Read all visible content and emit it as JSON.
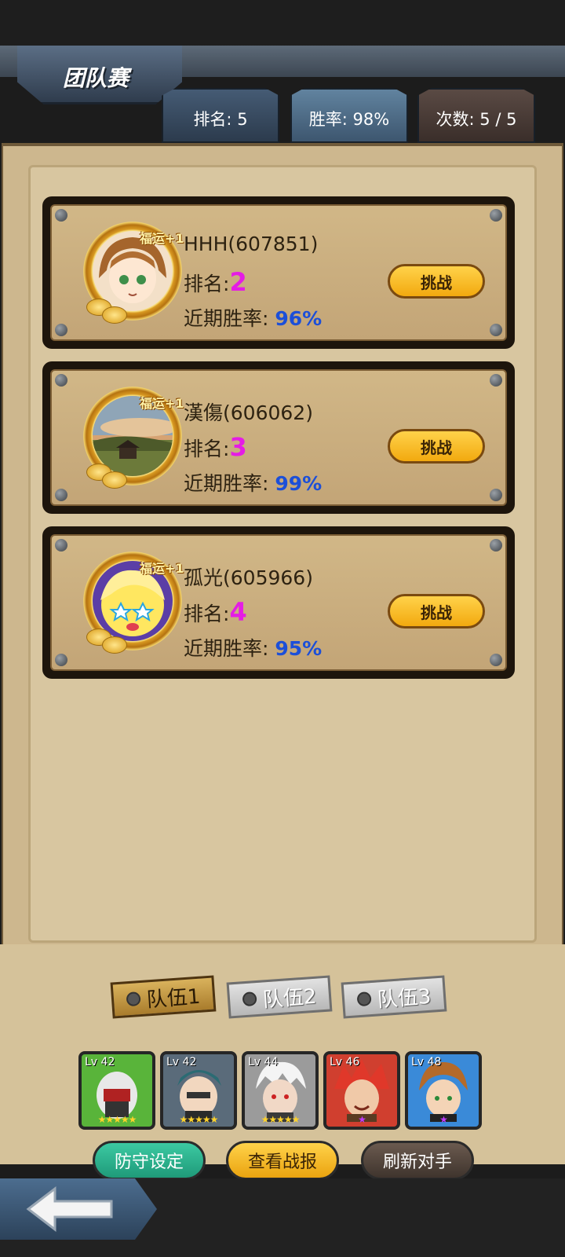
{
  "header": {
    "title": "团队赛",
    "stats": [
      {
        "label": "排名: 5"
      },
      {
        "label": "胜率: 98%"
      },
      {
        "label": "次数: 5 / 5"
      }
    ]
  },
  "opponents": [
    {
      "name": "HHH(607851)",
      "rank_label": "排名:",
      "rank": "2",
      "winrate_label": "近期胜率:",
      "winrate": "96%",
      "luck": "福运+1",
      "button": "挑战"
    },
    {
      "name": "漢傷(606062)",
      "rank_label": "排名:",
      "rank": "3",
      "winrate_label": "近期胜率:",
      "winrate": "99%",
      "luck": "福运+1",
      "button": "挑战"
    },
    {
      "name": "孤光(605966)",
      "rank_label": "排名:",
      "rank": "4",
      "winrate_label": "近期胜率:",
      "winrate": "95%",
      "luck": "福运+1",
      "button": "挑战"
    }
  ],
  "teams": {
    "tabs": [
      "队伍1",
      "队伍2",
      "队伍3"
    ],
    "selected": "队伍1"
  },
  "heroes": [
    {
      "level": "Lv 42",
      "stars": "★★★★★",
      "frame_color": "#59b43a"
    },
    {
      "level": "Lv 42",
      "stars": "★★★★★",
      "frame_color": "#5a6b7a"
    },
    {
      "level": "Lv 44",
      "stars": "★★★★★",
      "frame_color": "#9b9b9b"
    },
    {
      "level": "Lv 46",
      "stars": "★",
      "frame_color": "#d03f2f"
    },
    {
      "level": "Lv 48",
      "stars": "★",
      "frame_color": "#3a8ad8"
    }
  ],
  "actions": {
    "defense": "防守设定",
    "report": "查看战报",
    "refresh": "刷新对手"
  },
  "icons": {
    "back": "back-arrow-icon"
  }
}
